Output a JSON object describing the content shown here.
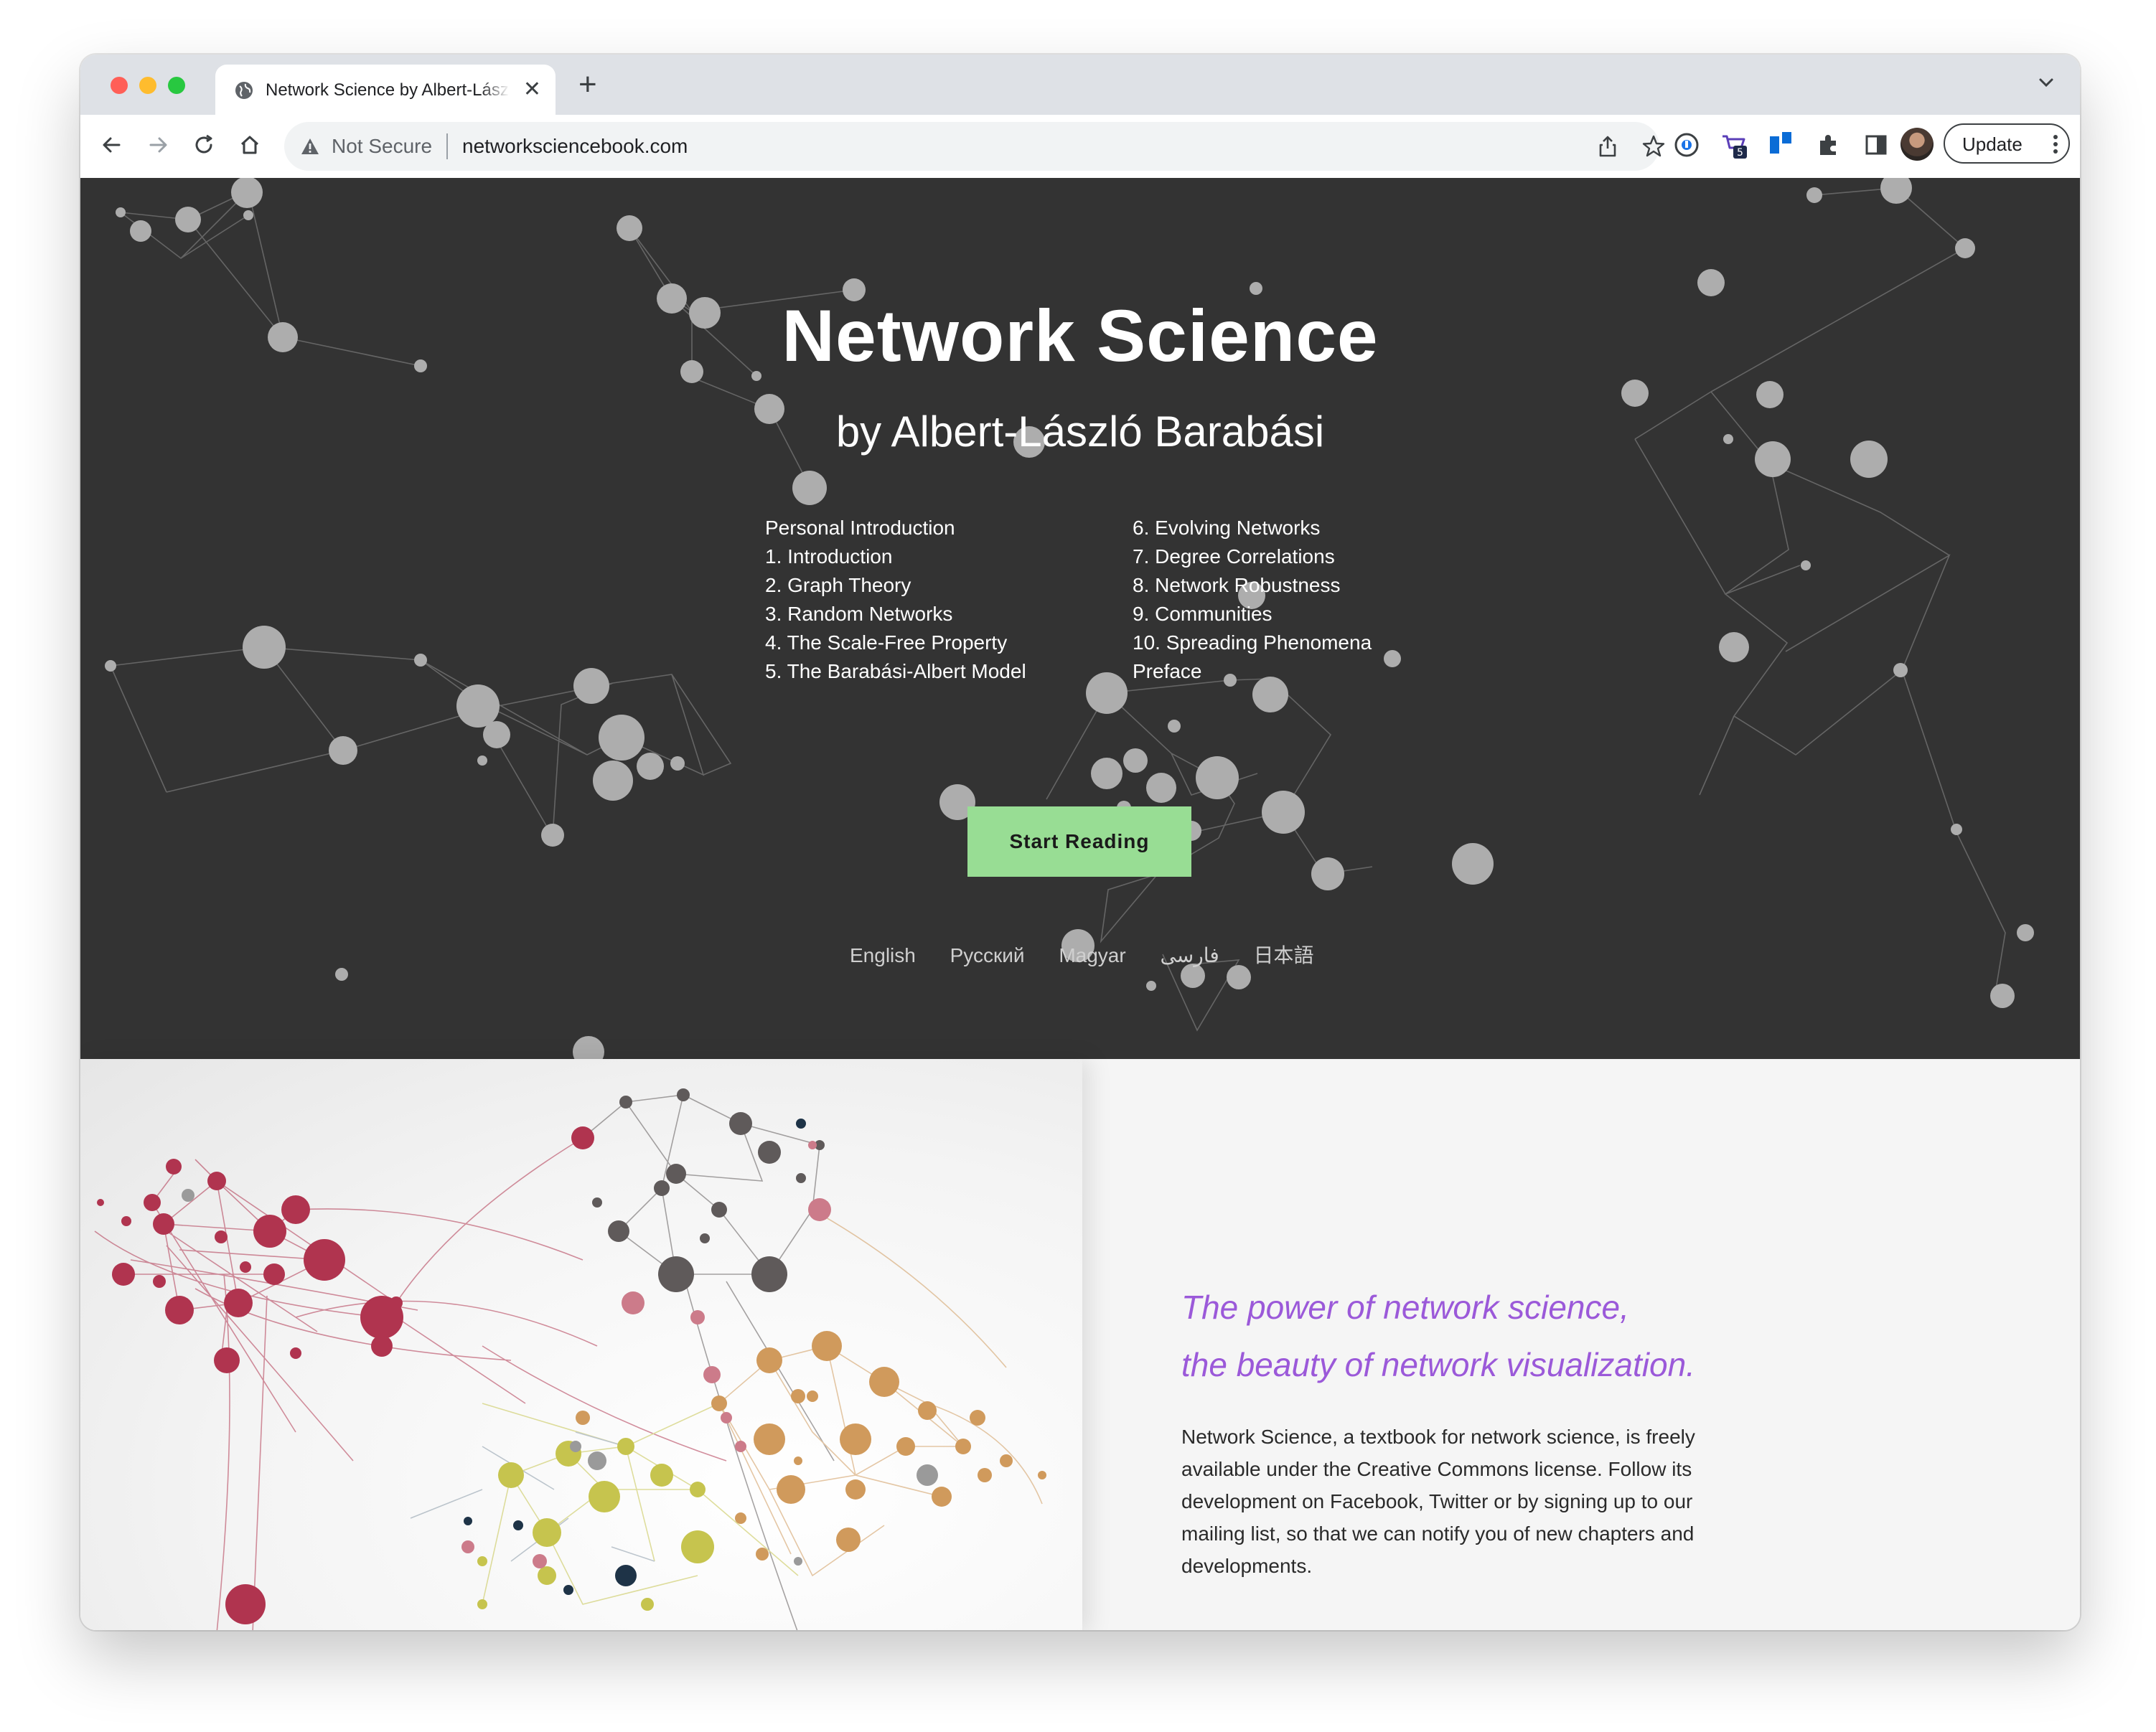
{
  "browser": {
    "tab_title": "Network Science by Albert-László Barabási",
    "security_label": "Not Secure",
    "url": "networksciencebook.com",
    "update_label": "Update",
    "extension_badge": "5"
  },
  "hero": {
    "title": "Network Science",
    "subtitle": "by Albert-László Barabási",
    "toc_left": [
      "Personal Introduction",
      "1. Introduction",
      "2. Graph Theory",
      "3. Random Networks",
      "4. The Scale-Free Property",
      "5. The Barabási-Albert Model"
    ],
    "toc_right": [
      "6. Evolving Networks",
      "7. Degree Correlations",
      "8. Network Robustness",
      "9. Communities",
      "10. Spreading Phenomena",
      "Preface"
    ],
    "cta_label": "Start Reading",
    "languages": [
      "English",
      "Русский",
      "Magyar",
      "فارسی",
      "日本語"
    ]
  },
  "feature": {
    "tagline_line1": "The power of network science,",
    "tagline_line2": "the beauty of network visualization.",
    "description": "Network Science, a textbook for network science, is freely available under the Creative Commons license. Follow its development on Facebook, Twitter or by signing up to our mailing list, so that we can notify you of new chapters and developments."
  },
  "colors": {
    "hero_bg": "#333333",
    "cta_bg": "#98dd94",
    "tagline": "#9b59d9",
    "community_colors": [
      "#b0344f",
      "#5f5a5a",
      "#d09a5c",
      "#c6c44e",
      "#1e3347",
      "#cc7b8a"
    ]
  },
  "icons": [
    "globe-icon",
    "close-icon",
    "plus-icon",
    "chevron-down-icon",
    "back-arrow-icon",
    "forward-arrow-icon",
    "reload-icon",
    "home-icon",
    "warning-icon",
    "share-icon",
    "star-icon",
    "password-icon",
    "cart-icon",
    "trello-icon",
    "puzzle-icon",
    "sidepanel-icon",
    "kebab-menu-icon"
  ]
}
